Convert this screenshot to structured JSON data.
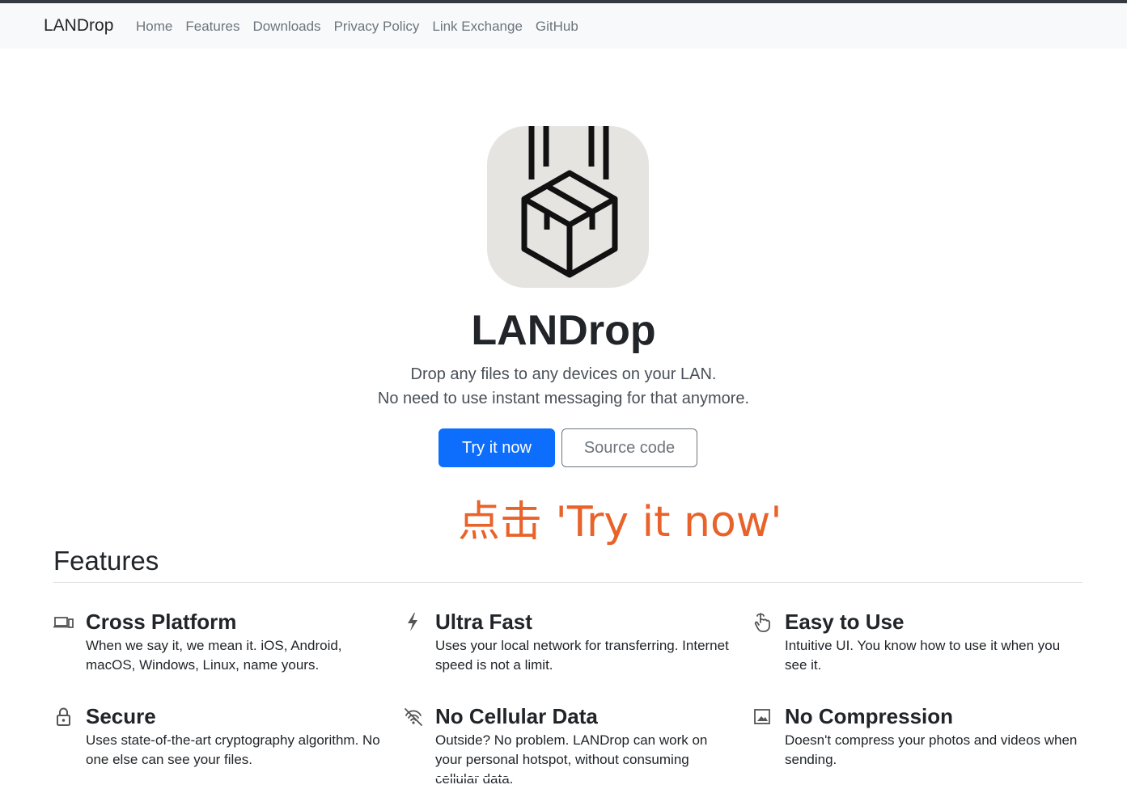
{
  "navbar": {
    "brand": "LANDrop",
    "links": [
      "Home",
      "Features",
      "Downloads",
      "Privacy Policy",
      "Link Exchange",
      "GitHub"
    ]
  },
  "hero": {
    "logo_icon": "falling-box-icon",
    "title": "LANDrop",
    "lead_line1": "Drop any files to any devices on your LAN.",
    "lead_line2": "No need to use instant messaging for that anymore.",
    "primary_button": "Try it now",
    "secondary_button": "Source code"
  },
  "annotation": "点击 'Try it now'",
  "features": {
    "heading": "Features",
    "items": [
      {
        "icon": "devices-icon",
        "title": "Cross Platform",
        "desc": "When we say it, we mean it. iOS, Android, macOS, Windows, Linux, name yours."
      },
      {
        "icon": "lightning-icon",
        "title": "Ultra Fast",
        "desc": "Uses your local network for transferring. Internet speed is not a limit."
      },
      {
        "icon": "hand-pointer-icon",
        "title": "Easy to Use",
        "desc": "Intuitive UI. You know how to use it when you see it."
      },
      {
        "icon": "lock-icon",
        "title": "Secure",
        "desc": "Uses state-of-the-art cryptography algorithm. No one else can see your files."
      },
      {
        "icon": "no-signal-icon",
        "title": "No Cellular Data",
        "desc": "Outside? No problem. LANDrop can work on your personal hotspot, without consuming cellular data."
      },
      {
        "icon": "image-icon",
        "title": "No Compression",
        "desc": "Doesn't compress your photos and videos when sending."
      }
    ]
  },
  "colors": {
    "primary": "#0d6efd",
    "annotation": "#e8622a",
    "navbar_bg": "#f8f9fa"
  }
}
